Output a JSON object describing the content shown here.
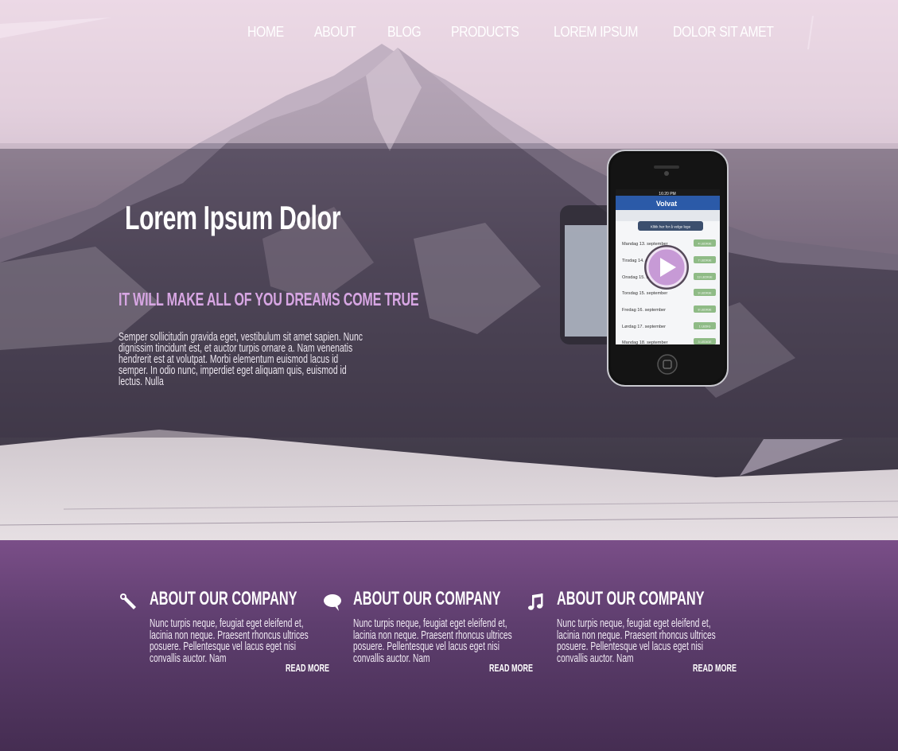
{
  "nav": {
    "items": [
      {
        "label": "HOME"
      },
      {
        "label": "ABOUT"
      },
      {
        "label": "BLOG"
      },
      {
        "label": "PRODUCTS"
      },
      {
        "label": "LOREM IPSUM"
      },
      {
        "label": "DOLOR SIT AMET"
      }
    ]
  },
  "hero": {
    "title": "Lorem Ipsum Dolor",
    "subtitle": "IT WILL MAKE ALL OF YOU DREAMS COME TRUE",
    "body": "Semper sollicitudin gravida eget, vestibulum sit amet sapien. Nunc dignissim tincidunt est, et auctor turpis ornare a. Nam venenatis hendrerit est at volutpat. Morbi elementum euismod lacus id semper. In odio nunc, imperdiet eget aliquam quis, euismod id lectus. Nulla"
  },
  "phone": {
    "time": "16:20 PM",
    "brand": "Volvat",
    "button": "Klikk her for å velge lege",
    "rows": [
      {
        "day": "Mandag 13. september",
        "badge": "4 LEDIGE"
      },
      {
        "day": "Tirsdag 14. september",
        "badge": "7 LEDIGE"
      },
      {
        "day": "Onsdag 15. september",
        "badge": "13 LEDIGE"
      },
      {
        "day": "Torsdag 15. september",
        "badge": "9 LEDIGE"
      },
      {
        "day": "Fredag 16. september",
        "badge": "8 LEDIGE"
      },
      {
        "day": "Lørdag 17. september",
        "badge": "1 LEDIG"
      },
      {
        "day": "Mandag 18. september",
        "badge": "3 LEDIGE"
      }
    ]
  },
  "features": [
    {
      "icon": "wrench-icon",
      "title": "ABOUT OUR COMPANY",
      "body": "Nunc turpis neque, feugiat eget eleifend et, lacinia non neque. Praesent rhoncus ultrices posuere. Pellentesque vel lacus eget nisi convallis auctor. Nam",
      "more": "READ MORE"
    },
    {
      "icon": "speech-bubble-icon",
      "title": "ABOUT OUR COMPANY",
      "body": "Nunc turpis neque, feugiat eget eleifend et, lacinia non neque. Praesent rhoncus ultrices posuere. Pellentesque vel lacus eget nisi convallis auctor. Nam",
      "more": "READ MORE"
    },
    {
      "icon": "music-note-icon",
      "title": "ABOUT OUR COMPANY",
      "body": "Nunc turpis neque, feugiat eget eleifend et, lacinia non neque. Praesent rhoncus ultrices posuere. Pellentesque vel lacus eget nisi convallis auctor. Nam",
      "more": "READ MORE"
    }
  ],
  "colors": {
    "accent": "#d7a6e3",
    "features_top": "#7a4e88",
    "features_bottom": "#452d52"
  }
}
